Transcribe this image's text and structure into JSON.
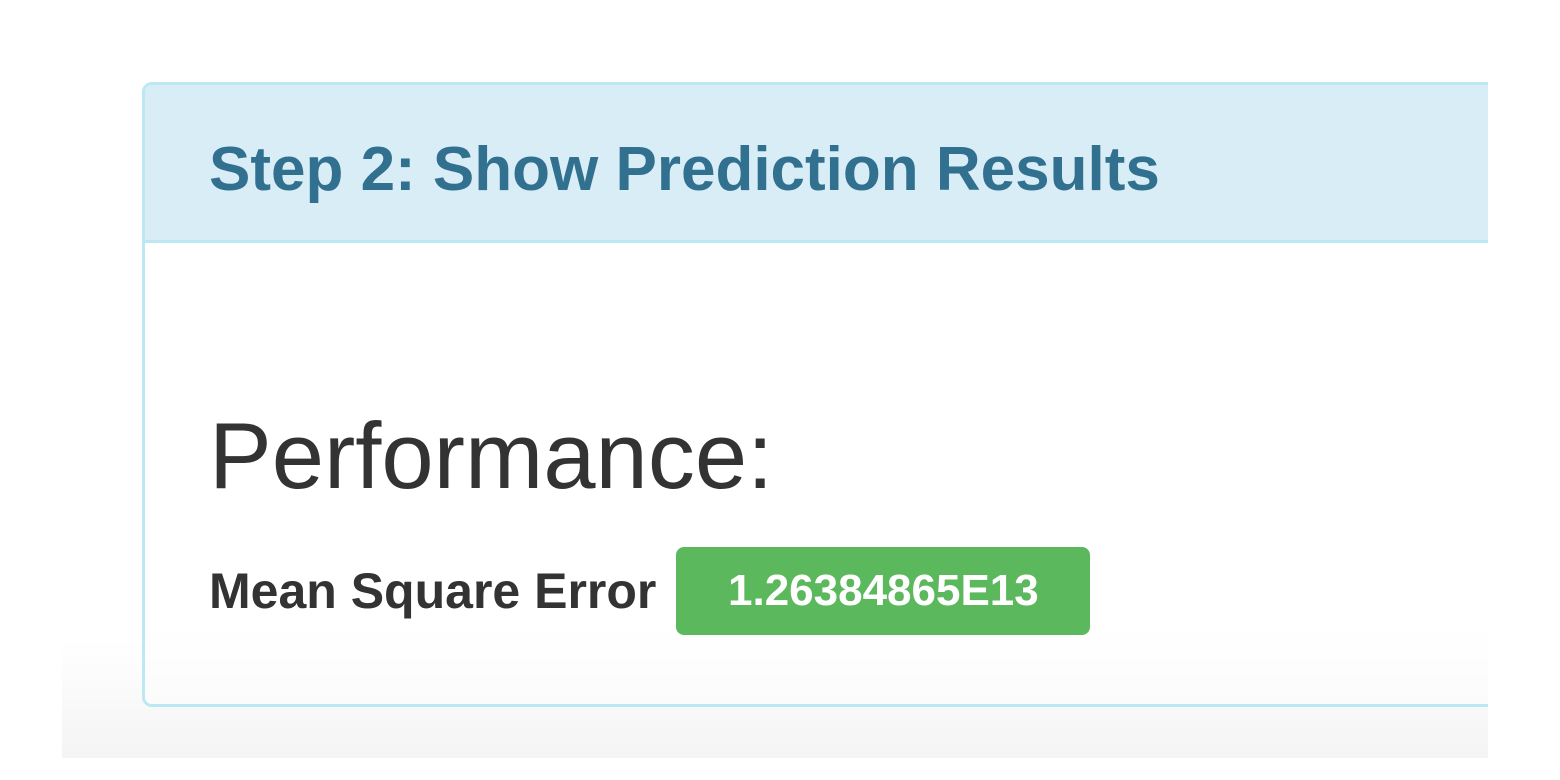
{
  "panel": {
    "title": "Step 2: Show Prediction Results"
  },
  "performance": {
    "heading": "Performance:",
    "metric_label": "Mean Square Error",
    "metric_value": "1.26384865E13"
  },
  "colors": {
    "panel_heading_bg": "#d9edf7",
    "panel_border": "#bce8f1",
    "panel_title_text": "#31708f",
    "body_text": "#333333",
    "badge_bg": "#5cb85c",
    "badge_text": "#ffffff"
  }
}
